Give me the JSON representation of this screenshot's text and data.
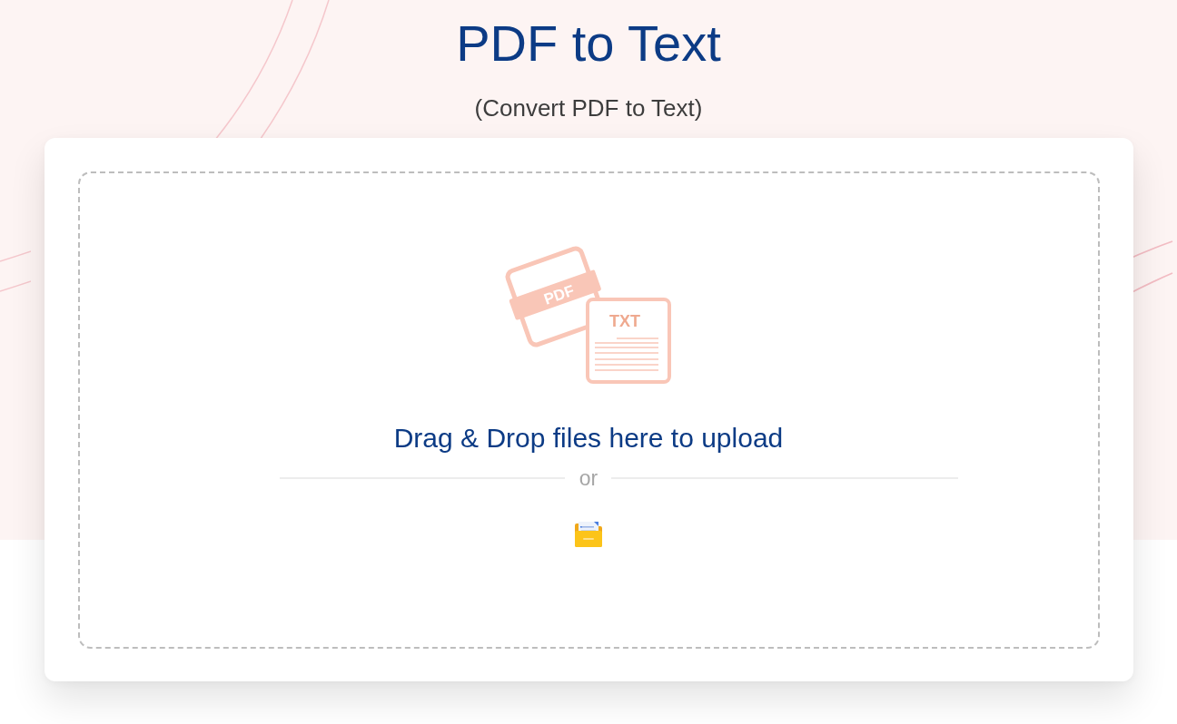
{
  "header": {
    "title": "PDF to Text",
    "subtitle": "(Convert PDF to Text)"
  },
  "upload": {
    "illustration": {
      "source_label": "PDF",
      "target_label": "TXT"
    },
    "prompt": "Drag & Drop files here to upload",
    "separator": "or"
  }
}
